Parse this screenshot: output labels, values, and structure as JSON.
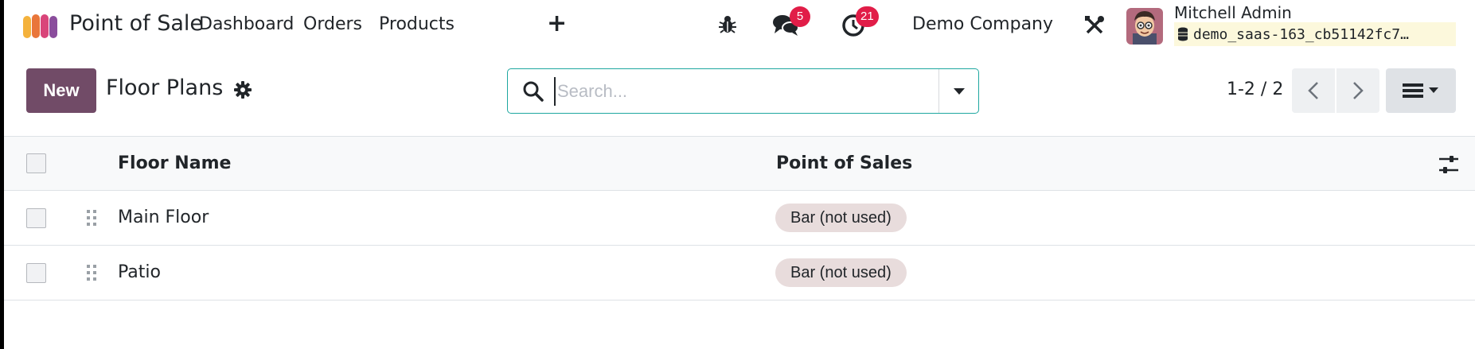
{
  "navbar": {
    "app_name": "Point of Sale",
    "menu": [
      "Dashboard",
      "Orders",
      "Products"
    ],
    "new_menu_icon": "plus-icon",
    "debug_icon": "bug-icon",
    "messages_icon": "chat-icon",
    "messages_count": "5",
    "activities_icon": "clock-icon",
    "activities_count": "21",
    "company": "Demo Company",
    "settings_icon": "tools-icon",
    "user_name": "Mitchell Admin",
    "database": "demo_saas-163_cb51142fc7…"
  },
  "control_panel": {
    "new_label": "New",
    "title": "Floor Plans",
    "search_placeholder": "Search...",
    "pager": "1-2 / 2"
  },
  "table": {
    "columns": [
      "Floor Name",
      "Point of Sales"
    ],
    "rows": [
      {
        "floor_name": "Main Floor",
        "point_of_sales": "Bar (not used)"
      },
      {
        "floor_name": "Patio",
        "point_of_sales": "Bar (not used)"
      }
    ]
  },
  "colors": {
    "brand": "#714b67",
    "badge": "#e11d48",
    "search_border": "#1ea7a0",
    "tag_bg": "#e8dcdc"
  }
}
